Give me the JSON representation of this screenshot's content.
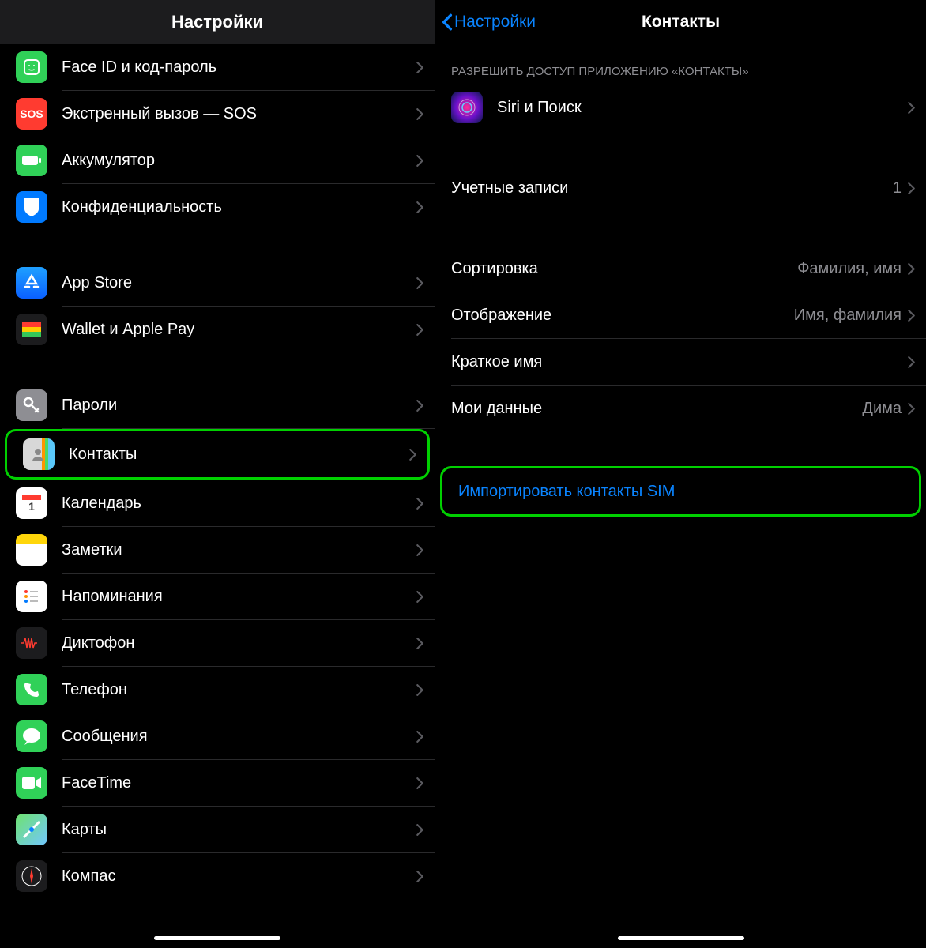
{
  "left": {
    "title": "Настройки",
    "group1": [
      {
        "label": "Face ID и код-пароль",
        "icon": "face-id-icon"
      },
      {
        "label": "Экстренный вызов — SOS",
        "icon": "sos-icon"
      },
      {
        "label": "Аккумулятор",
        "icon": "battery-icon"
      },
      {
        "label": "Конфиденциальность",
        "icon": "privacy-icon"
      }
    ],
    "group2": [
      {
        "label": "App Store",
        "icon": "appstore-icon"
      },
      {
        "label": "Wallet и Apple Pay",
        "icon": "wallet-icon"
      }
    ],
    "group3": [
      {
        "label": "Пароли",
        "icon": "passwords-icon"
      },
      {
        "label": "Контакты",
        "icon": "contacts-icon",
        "highlighted": true
      },
      {
        "label": "Календарь",
        "icon": "calendar-icon"
      },
      {
        "label": "Заметки",
        "icon": "notes-icon"
      },
      {
        "label": "Напоминания",
        "icon": "reminders-icon"
      },
      {
        "label": "Диктофон",
        "icon": "voicememo-icon"
      },
      {
        "label": "Телефон",
        "icon": "phone-icon"
      },
      {
        "label": "Сообщения",
        "icon": "messages-icon"
      },
      {
        "label": "FaceTime",
        "icon": "facetime-icon"
      },
      {
        "label": "Карты",
        "icon": "maps-icon"
      },
      {
        "label": "Компас",
        "icon": "compass-icon"
      }
    ]
  },
  "right": {
    "back_label": "Настройки",
    "title": "Контакты",
    "section_header": "РАЗРЕШИТЬ ДОСТУП ПРИЛОЖЕНИЮ «КОНТАКТЫ»",
    "siri_label": "Siri и Поиск",
    "accounts": {
      "label": "Учетные записи",
      "value": "1"
    },
    "sort": {
      "label": "Сортировка",
      "value": "Фамилия, имя"
    },
    "display": {
      "label": "Отображение",
      "value": "Имя, фамилия"
    },
    "shortname": {
      "label": "Краткое имя"
    },
    "mydata": {
      "label": "Мои данные",
      "value": "Дима"
    },
    "import_sim": "Импортировать контакты SIM"
  }
}
